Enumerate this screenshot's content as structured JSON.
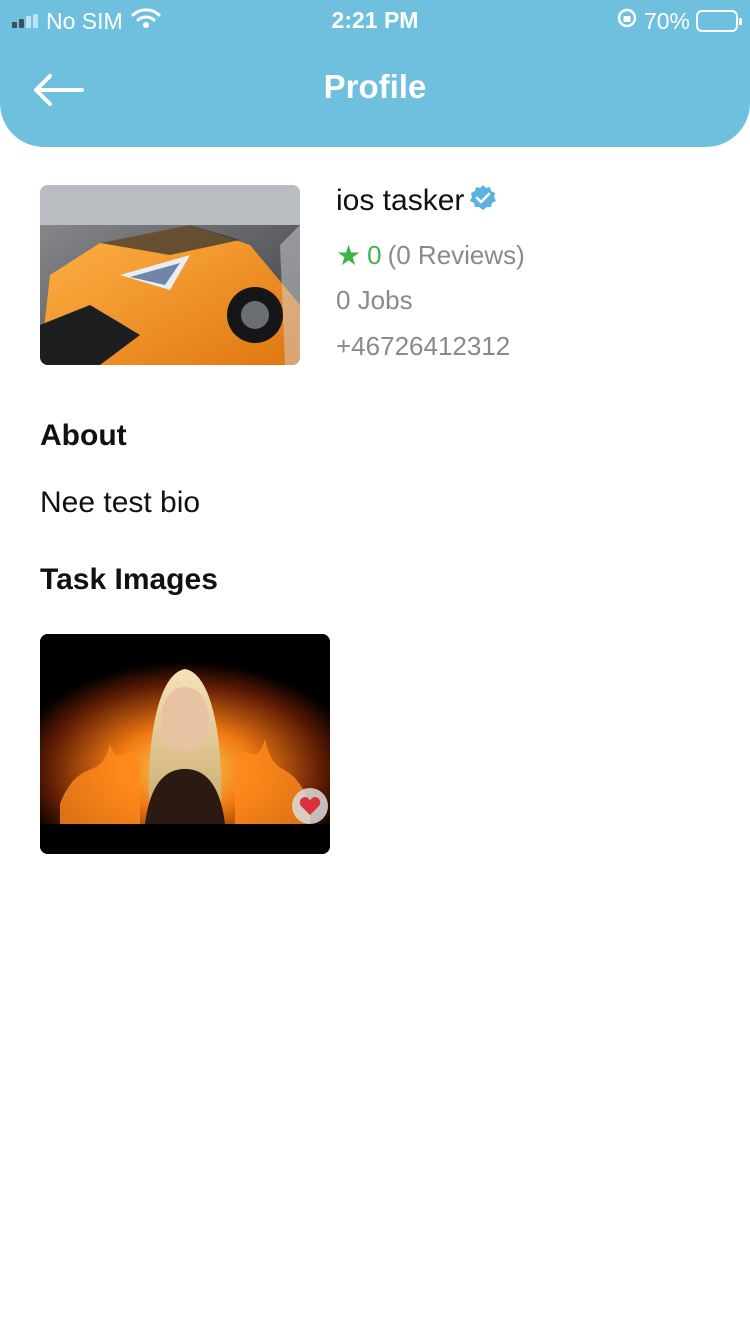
{
  "status_bar": {
    "carrier": "No SIM",
    "time": "2:21 PM",
    "battery": "70%",
    "battery_level": 0.7
  },
  "header": {
    "title": "Profile",
    "back_icon": "arrow-left-icon",
    "background_color": "#6fc0df"
  },
  "profile": {
    "name": "ios tasker",
    "verified_icon": "verified-badge-icon",
    "rating_score": "0",
    "reviews": "(0 Reviews)",
    "jobs": "0 Jobs",
    "phone": "+46726412312",
    "accent_color": "#3bb54a"
  },
  "about": {
    "heading": "About",
    "bio": "Nee test bio"
  },
  "task_images": {
    "heading": "Task Images",
    "favorite_icon": "heart-icon"
  }
}
